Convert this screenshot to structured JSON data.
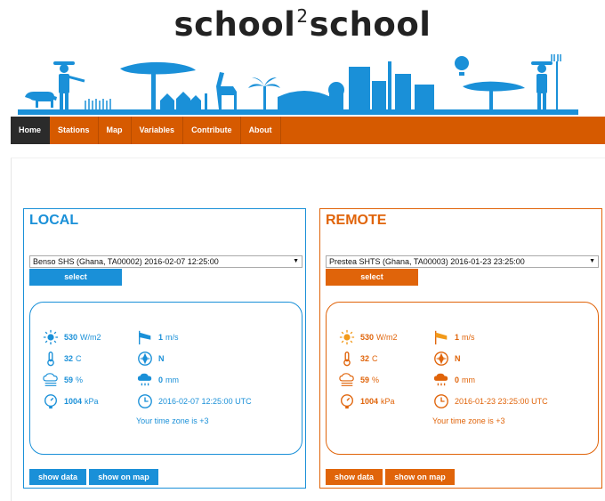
{
  "header": {
    "logo_part1": "school",
    "logo_sup": "2",
    "logo_part2": "school"
  },
  "nav": {
    "items": [
      {
        "label": "Home",
        "active": true
      },
      {
        "label": "Stations"
      },
      {
        "label": "Map"
      },
      {
        "label": "Variables"
      },
      {
        "label": "Contribute"
      },
      {
        "label": "About"
      }
    ]
  },
  "colors": {
    "local": "#1a90d8",
    "remote": "#e0640a",
    "nav": "#d65a00",
    "nav_active": "#2b2b2b"
  },
  "local": {
    "title": "LOCAL",
    "station_select": "Benso SHS (Ghana, TA00002) 2016-02-07 12:25:00",
    "select_button": "select",
    "irradiance_value": "530",
    "irradiance_unit": "W/m2",
    "temperature_value": "32",
    "temperature_unit": "C",
    "humidity_value": "59",
    "humidity_unit": "%",
    "pressure_value": "1004",
    "pressure_unit": "kPa",
    "wind_speed_value": "1",
    "wind_speed_unit": "m/s",
    "wind_direction": "N",
    "precipitation_value": "0",
    "precipitation_unit": "mm",
    "timestamp": "2016-02-07 12:25:00 UTC",
    "timezone_note": "Your time zone is +3",
    "show_data": "show data",
    "show_on_map": "show on map"
  },
  "remote": {
    "title": "REMOTE",
    "station_select": "Prestea SHTS (Ghana, TA00003) 2016-01-23 23:25:00",
    "select_button": "select",
    "irradiance_value": "530",
    "irradiance_unit": "W/m2",
    "temperature_value": "32",
    "temperature_unit": "C",
    "humidity_value": "59",
    "humidity_unit": "%",
    "pressure_value": "1004",
    "pressure_unit": "kPa",
    "wind_speed_value": "1",
    "wind_speed_unit": "m/s",
    "wind_direction": "N",
    "precipitation_value": "0",
    "precipitation_unit": "mm",
    "timestamp": "2016-01-23 23:25:00 UTC",
    "timezone_note": "Your time zone is +3",
    "show_data": "show data",
    "show_on_map": "show on map"
  }
}
